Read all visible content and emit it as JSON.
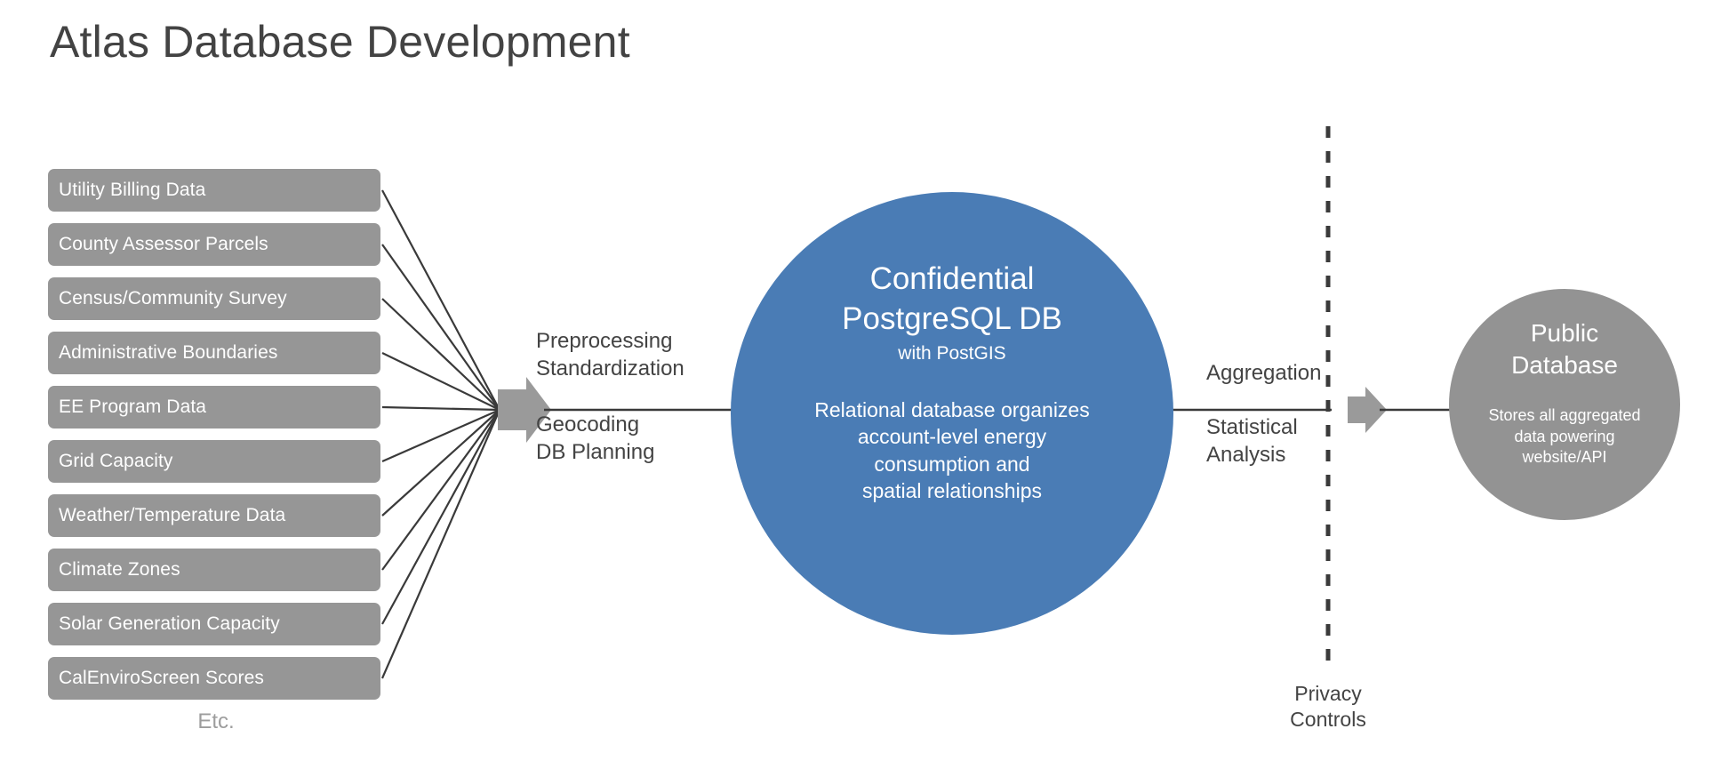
{
  "page": {
    "title": "Atlas Database Development",
    "background": "#ffffff"
  },
  "colors": {
    "source_box": "#969696",
    "confidential_circle": "#4a7cb5",
    "public_circle": "#939393",
    "text_dark": "#434343",
    "arrow_gray": "#9a9a9a",
    "line": "#3a3a3a"
  },
  "sources": {
    "items": [
      {
        "label": "Utility Billing Data"
      },
      {
        "label": "County Assessor Parcels"
      },
      {
        "label": "Census/Community Survey"
      },
      {
        "label": "Administrative Boundaries"
      },
      {
        "label": "EE Program Data"
      },
      {
        "label": "Grid Capacity"
      },
      {
        "label": "Weather/Temperature Data"
      },
      {
        "label": "Climate Zones"
      },
      {
        "label": "Solar Generation Capacity"
      },
      {
        "label": "CalEnviroScreen Scores"
      }
    ],
    "etc": "Etc."
  },
  "process": {
    "preprocessing": "Preprocessing\nStandardization",
    "geocoding": "Geocoding\nDB Planning",
    "aggregation": "Aggregation",
    "statistical": "Statistical\nAnalysis"
  },
  "confidential": {
    "title": "Confidential\nPostgreSQL DB",
    "subtitle": "with PostGIS",
    "description": "Relational database organizes\naccount-level energy\nconsumption and\nspatial relationships"
  },
  "privacy": {
    "label": "Privacy\nControls"
  },
  "public": {
    "title": "Public\nDatabase",
    "description": "Stores all aggregated\ndata powering\nwebsite/API"
  }
}
